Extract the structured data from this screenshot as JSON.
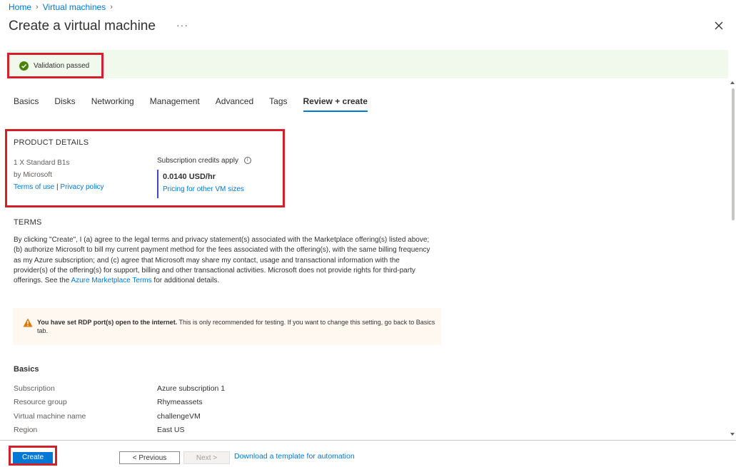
{
  "breadcrumb": {
    "home": "Home",
    "parent": "Virtual machines"
  },
  "header": {
    "title": "Create a virtual machine",
    "more_glyph": "···"
  },
  "validation": {
    "text": "Validation passed"
  },
  "tabs": [
    {
      "label": "Basics"
    },
    {
      "label": "Disks"
    },
    {
      "label": "Networking"
    },
    {
      "label": "Management"
    },
    {
      "label": "Advanced"
    },
    {
      "label": "Tags"
    },
    {
      "label": "Review + create",
      "active": true
    }
  ],
  "product": {
    "heading": "PRODUCT DETAILS",
    "name": "1 X Standard B1s",
    "publisher": "by Microsoft",
    "terms_link": "Terms of use",
    "separator": "|",
    "privacy_link": "Privacy policy",
    "credits_label": "Subscription credits apply",
    "price": "0.0140 USD/hr",
    "pricing_link": "Pricing for other VM sizes"
  },
  "terms": {
    "heading": "TERMS",
    "text_before_link": "By clicking \"Create\", I (a) agree to the legal terms and privacy statement(s) associated with the Marketplace offering(s) listed above; (b) authorize Microsoft to bill my current payment method for the fees associated with the offering(s), with the same billing frequency as my Azure subscription; and (c) agree that Microsoft may share my contact, usage and transactional information with the provider(s) of the offering(s) for support, billing and other transactional activities. Microsoft does not provide rights for third-party offerings. See the ",
    "link_text": "Azure Marketplace Terms",
    "text_after_link": " for additional details."
  },
  "warning": {
    "bold": "You have set RDP port(s) open to the internet.",
    "text": " This is only recommended for testing.  If you want to change this setting, go back to Basics tab."
  },
  "basics": {
    "heading": "Basics",
    "rows": [
      {
        "label": "Subscription",
        "value": "Azure subscription 1"
      },
      {
        "label": "Resource group",
        "value": "Rhymeassets"
      },
      {
        "label": "Virtual machine name",
        "value": "challengeVM"
      },
      {
        "label": "Region",
        "value": "East US"
      }
    ]
  },
  "footer": {
    "create_label": "Create",
    "previous_label": "< Previous",
    "next_label": "Next >",
    "template_link": "Download a template for automation"
  },
  "colors": {
    "accent": "#0078d4",
    "highlight_border": "#d4202a",
    "success": "#498205",
    "warning": "#d87900"
  }
}
